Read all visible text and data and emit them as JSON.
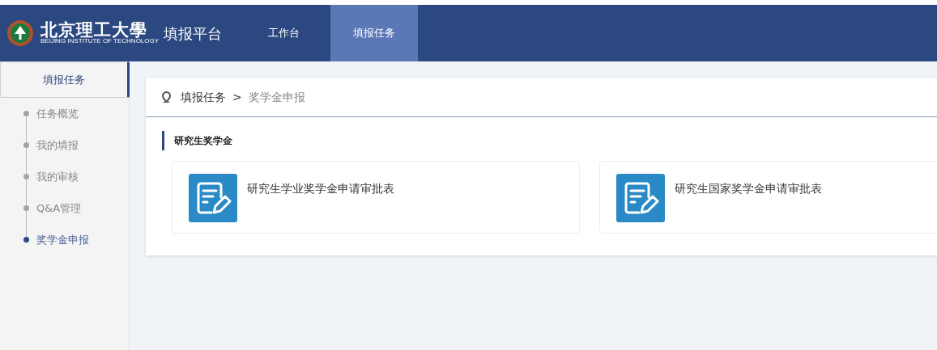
{
  "header": {
    "logo_text": "北京理工大學",
    "logo_subtitle": "BEIJING INSTITUTE OF TECHNOLOGY",
    "platform": "填报平台",
    "tabs": [
      {
        "label": "工作台",
        "selected": false
      },
      {
        "label": "填报任务",
        "selected": true
      }
    ]
  },
  "sidebar": {
    "heading": "填报任务",
    "items": [
      {
        "label": "任务概览",
        "selected": false
      },
      {
        "label": "我的填报",
        "selected": false
      },
      {
        "label": "我的审核",
        "selected": false
      },
      {
        "label": "Q&A管理",
        "selected": false
      },
      {
        "label": "奖学金申报",
        "selected": true
      }
    ]
  },
  "breadcrumb": [
    "填报任务",
    "奖学金申报"
  ],
  "breadcrumb_separator": ">",
  "section": {
    "title": "研究生奖学金",
    "cards": [
      {
        "title": "研究生学业奖学金申请审批表"
      },
      {
        "title": "研究生国家奖学金申请审批表"
      }
    ]
  }
}
